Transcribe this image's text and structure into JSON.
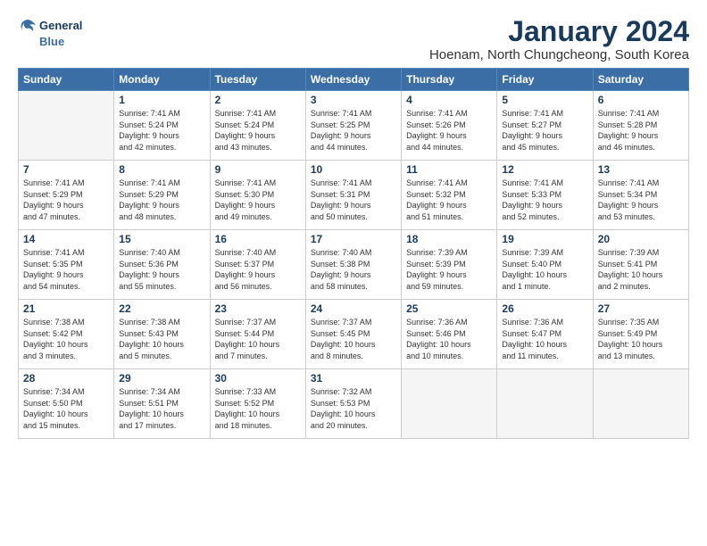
{
  "logo": {
    "line1": "General",
    "line2": "Blue"
  },
  "title": "January 2024",
  "subtitle": "Hoenam, North Chungcheong, South Korea",
  "days_of_week": [
    "Sunday",
    "Monday",
    "Tuesday",
    "Wednesday",
    "Thursday",
    "Friday",
    "Saturday"
  ],
  "weeks": [
    [
      {
        "day": "",
        "info": ""
      },
      {
        "day": "1",
        "info": "Sunrise: 7:41 AM\nSunset: 5:24 PM\nDaylight: 9 hours\nand 42 minutes."
      },
      {
        "day": "2",
        "info": "Sunrise: 7:41 AM\nSunset: 5:24 PM\nDaylight: 9 hours\nand 43 minutes."
      },
      {
        "day": "3",
        "info": "Sunrise: 7:41 AM\nSunset: 5:25 PM\nDaylight: 9 hours\nand 44 minutes."
      },
      {
        "day": "4",
        "info": "Sunrise: 7:41 AM\nSunset: 5:26 PM\nDaylight: 9 hours\nand 44 minutes."
      },
      {
        "day": "5",
        "info": "Sunrise: 7:41 AM\nSunset: 5:27 PM\nDaylight: 9 hours\nand 45 minutes."
      },
      {
        "day": "6",
        "info": "Sunrise: 7:41 AM\nSunset: 5:28 PM\nDaylight: 9 hours\nand 46 minutes."
      }
    ],
    [
      {
        "day": "7",
        "info": "Sunrise: 7:41 AM\nSunset: 5:29 PM\nDaylight: 9 hours\nand 47 minutes."
      },
      {
        "day": "8",
        "info": "Sunrise: 7:41 AM\nSunset: 5:29 PM\nDaylight: 9 hours\nand 48 minutes."
      },
      {
        "day": "9",
        "info": "Sunrise: 7:41 AM\nSunset: 5:30 PM\nDaylight: 9 hours\nand 49 minutes."
      },
      {
        "day": "10",
        "info": "Sunrise: 7:41 AM\nSunset: 5:31 PM\nDaylight: 9 hours\nand 50 minutes."
      },
      {
        "day": "11",
        "info": "Sunrise: 7:41 AM\nSunset: 5:32 PM\nDaylight: 9 hours\nand 51 minutes."
      },
      {
        "day": "12",
        "info": "Sunrise: 7:41 AM\nSunset: 5:33 PM\nDaylight: 9 hours\nand 52 minutes."
      },
      {
        "day": "13",
        "info": "Sunrise: 7:41 AM\nSunset: 5:34 PM\nDaylight: 9 hours\nand 53 minutes."
      }
    ],
    [
      {
        "day": "14",
        "info": "Sunrise: 7:41 AM\nSunset: 5:35 PM\nDaylight: 9 hours\nand 54 minutes."
      },
      {
        "day": "15",
        "info": "Sunrise: 7:40 AM\nSunset: 5:36 PM\nDaylight: 9 hours\nand 55 minutes."
      },
      {
        "day": "16",
        "info": "Sunrise: 7:40 AM\nSunset: 5:37 PM\nDaylight: 9 hours\nand 56 minutes."
      },
      {
        "day": "17",
        "info": "Sunrise: 7:40 AM\nSunset: 5:38 PM\nDaylight: 9 hours\nand 58 minutes."
      },
      {
        "day": "18",
        "info": "Sunrise: 7:39 AM\nSunset: 5:39 PM\nDaylight: 9 hours\nand 59 minutes."
      },
      {
        "day": "19",
        "info": "Sunrise: 7:39 AM\nSunset: 5:40 PM\nDaylight: 10 hours\nand 1 minute."
      },
      {
        "day": "20",
        "info": "Sunrise: 7:39 AM\nSunset: 5:41 PM\nDaylight: 10 hours\nand 2 minutes."
      }
    ],
    [
      {
        "day": "21",
        "info": "Sunrise: 7:38 AM\nSunset: 5:42 PM\nDaylight: 10 hours\nand 3 minutes."
      },
      {
        "day": "22",
        "info": "Sunrise: 7:38 AM\nSunset: 5:43 PM\nDaylight: 10 hours\nand 5 minutes."
      },
      {
        "day": "23",
        "info": "Sunrise: 7:37 AM\nSunset: 5:44 PM\nDaylight: 10 hours\nand 7 minutes."
      },
      {
        "day": "24",
        "info": "Sunrise: 7:37 AM\nSunset: 5:45 PM\nDaylight: 10 hours\nand 8 minutes."
      },
      {
        "day": "25",
        "info": "Sunrise: 7:36 AM\nSunset: 5:46 PM\nDaylight: 10 hours\nand 10 minutes."
      },
      {
        "day": "26",
        "info": "Sunrise: 7:36 AM\nSunset: 5:47 PM\nDaylight: 10 hours\nand 11 minutes."
      },
      {
        "day": "27",
        "info": "Sunrise: 7:35 AM\nSunset: 5:49 PM\nDaylight: 10 hours\nand 13 minutes."
      }
    ],
    [
      {
        "day": "28",
        "info": "Sunrise: 7:34 AM\nSunset: 5:50 PM\nDaylight: 10 hours\nand 15 minutes."
      },
      {
        "day": "29",
        "info": "Sunrise: 7:34 AM\nSunset: 5:51 PM\nDaylight: 10 hours\nand 17 minutes."
      },
      {
        "day": "30",
        "info": "Sunrise: 7:33 AM\nSunset: 5:52 PM\nDaylight: 10 hours\nand 18 minutes."
      },
      {
        "day": "31",
        "info": "Sunrise: 7:32 AM\nSunset: 5:53 PM\nDaylight: 10 hours\nand 20 minutes."
      },
      {
        "day": "",
        "info": ""
      },
      {
        "day": "",
        "info": ""
      },
      {
        "day": "",
        "info": ""
      }
    ]
  ]
}
